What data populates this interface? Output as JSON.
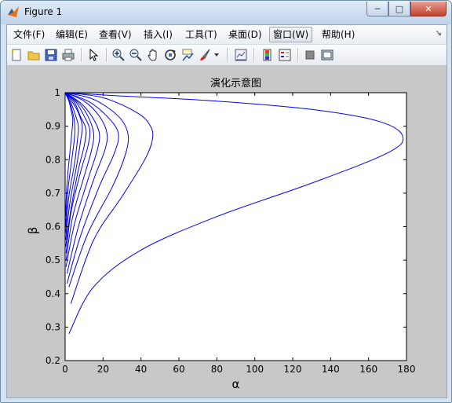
{
  "window": {
    "title": "Figure 1",
    "minimize_symbol": "─",
    "maximize_symbol": "□",
    "close_symbol": "✕"
  },
  "menu": {
    "items": [
      "文件(F)",
      "编辑(E)",
      "查看(V)",
      "插入(I)",
      "工具(T)",
      "桌面(D)",
      "窗口(W)",
      "帮助(H)"
    ],
    "active": "窗口(W)",
    "overflow_symbol": "↘"
  },
  "toolbar": {
    "icons": [
      "new-figure-icon",
      "open-icon",
      "save-icon",
      "print-icon",
      "pointer-icon",
      "zoom-in-icon",
      "zoom-out-icon",
      "pan-hand-icon",
      "rotate-3d-icon",
      "data-cursor-icon",
      "brush-icon",
      "brush-dropdown-icon",
      "link-plot-icon",
      "colorbar-icon",
      "legend-icon",
      "hide-plot-tools-icon",
      "show-plot-tools-icon"
    ]
  },
  "colors": {
    "curve": "#0000ff",
    "axes_bg": "#ffffff",
    "figure_bg": "#c8c8c8"
  },
  "chart_data": {
    "type": "line",
    "title": "演化示意图",
    "xlabel": "α",
    "ylabel": "β",
    "xlim": [
      0,
      180
    ],
    "ylim": [
      0.2,
      1
    ],
    "xticks": [
      0,
      20,
      40,
      60,
      80,
      100,
      120,
      140,
      160,
      180
    ],
    "yticks": [
      0.2,
      0.3,
      0.4,
      0.5,
      0.6,
      0.7,
      0.8,
      0.9,
      1
    ],
    "grid": false,
    "legend": "none",
    "series": [
      {
        "x": [
          0,
          30,
          80,
          130,
          165,
          178,
          170,
          130,
          80,
          40,
          15,
          2
        ],
        "y": [
          1,
          0.99,
          0.975,
          0.95,
          0.915,
          0.87,
          0.82,
          0.73,
          0.63,
          0.53,
          0.42,
          0.28
        ]
      },
      {
        "x": [
          0,
          20,
          38,
          45,
          46,
          42,
          30,
          15,
          3
        ],
        "y": [
          1,
          0.985,
          0.94,
          0.9,
          0.86,
          0.8,
          0.69,
          0.56,
          0.37
        ]
      },
      {
        "x": [
          0,
          15,
          28,
          33,
          32,
          25,
          12,
          2
        ],
        "y": [
          1,
          0.98,
          0.93,
          0.88,
          0.82,
          0.72,
          0.58,
          0.42
        ]
      },
      {
        "x": [
          0,
          12,
          22,
          28,
          26,
          18,
          8,
          1
        ],
        "y": [
          1,
          0.975,
          0.93,
          0.88,
          0.82,
          0.72,
          0.57,
          0.43
        ]
      },
      {
        "x": [
          0,
          10,
          18,
          22,
          21,
          15,
          7,
          1
        ],
        "y": [
          1,
          0.975,
          0.93,
          0.88,
          0.83,
          0.74,
          0.6,
          0.46
        ]
      },
      {
        "x": [
          0,
          8,
          14,
          18,
          17,
          12,
          5,
          0.5
        ],
        "y": [
          1,
          0.97,
          0.93,
          0.88,
          0.83,
          0.74,
          0.61,
          0.48
        ]
      },
      {
        "x": [
          0,
          7,
          12,
          15,
          14,
          10,
          4,
          0.5
        ],
        "y": [
          1,
          0.97,
          0.93,
          0.88,
          0.83,
          0.75,
          0.63,
          0.5
        ]
      },
      {
        "x": [
          0,
          6,
          10,
          13,
          12,
          8,
          3,
          0.5
        ],
        "y": [
          1,
          0.97,
          0.93,
          0.89,
          0.84,
          0.76,
          0.64,
          0.52
        ]
      },
      {
        "x": [
          0,
          5,
          8,
          11,
          10,
          7,
          3,
          0.3
        ],
        "y": [
          1,
          0.97,
          0.93,
          0.89,
          0.84,
          0.77,
          0.65,
          0.54
        ]
      },
      {
        "x": [
          0,
          4,
          7,
          9,
          8,
          6,
          2.5,
          0.3
        ],
        "y": [
          1,
          0.97,
          0.94,
          0.9,
          0.85,
          0.78,
          0.67,
          0.56
        ]
      },
      {
        "x": [
          0,
          3,
          5,
          7,
          6.5,
          5,
          2,
          0.3
        ],
        "y": [
          1,
          0.97,
          0.94,
          0.9,
          0.86,
          0.79,
          0.69,
          0.58
        ]
      },
      {
        "x": [
          0,
          2.5,
          4,
          5,
          5,
          3.5,
          1.5,
          0.2
        ],
        "y": [
          1,
          0.97,
          0.94,
          0.91,
          0.87,
          0.8,
          0.71,
          0.6
        ]
      },
      {
        "x": [
          0,
          2,
          3,
          4,
          3.5,
          2.5,
          1,
          0.2
        ],
        "y": [
          1,
          0.975,
          0.95,
          0.92,
          0.88,
          0.82,
          0.73,
          0.63
        ]
      }
    ]
  }
}
